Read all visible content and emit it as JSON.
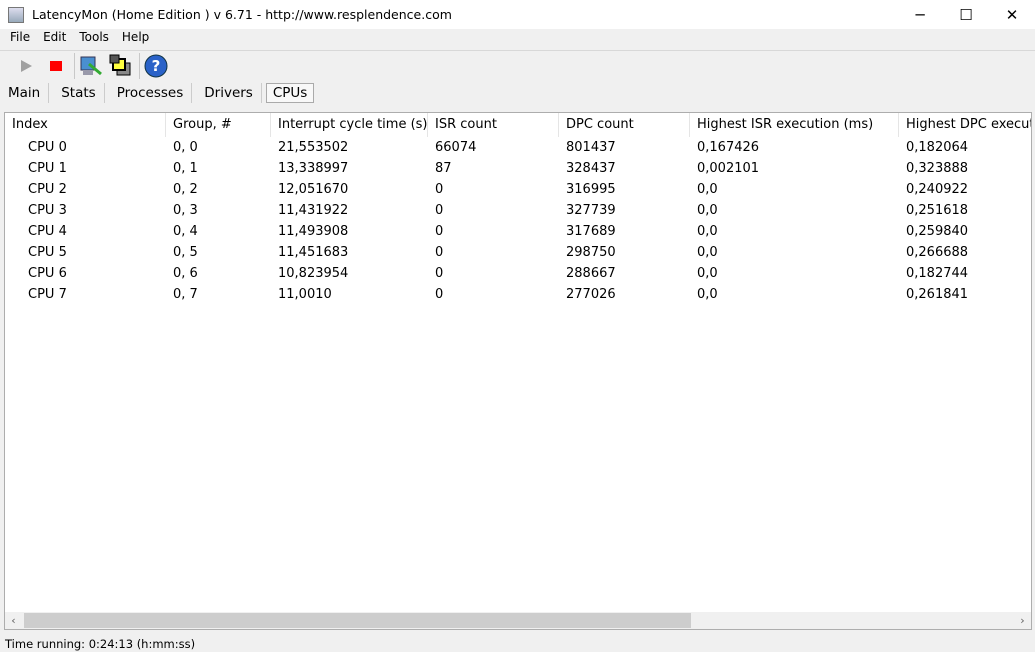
{
  "window": {
    "title": "LatencyMon  (Home Edition )  v 6.71 - http://www.resplendence.com",
    "minimize": "─",
    "maximize": "☐",
    "close": "✕"
  },
  "menu": [
    "File",
    "Edit",
    "Tools",
    "Help"
  ],
  "toolbar": {
    "icons": [
      "play-icon",
      "stop-icon",
      "monitor-icon",
      "windows-icon",
      "help-icon"
    ],
    "stop_color": "#ff0000",
    "help_label": "?"
  },
  "tabs": [
    {
      "label": "Main"
    },
    {
      "label": "Stats"
    },
    {
      "label": "Processes"
    },
    {
      "label": "Drivers"
    },
    {
      "label": "CPUs",
      "active": true
    }
  ],
  "table": {
    "columns": [
      "Index",
      "Group, #",
      "Interrupt cycle time (s)",
      "ISR count",
      "DPC count",
      "Highest ISR execution (ms)",
      "Highest DPC execution (ms)"
    ],
    "rows": [
      [
        "CPU 0",
        "0, 0",
        "21,553502",
        "66074",
        "801437",
        "0,167426",
        "0,182064"
      ],
      [
        "CPU 1",
        "0, 1",
        "13,338997",
        "87",
        "328437",
        "0,002101",
        "0,323888"
      ],
      [
        "CPU 2",
        "0, 2",
        "12,051670",
        "0",
        "316995",
        "0,0",
        "0,240922"
      ],
      [
        "CPU 3",
        "0, 3",
        "11,431922",
        "0",
        "327739",
        "0,0",
        "0,251618"
      ],
      [
        "CPU 4",
        "0, 4",
        "11,493908",
        "0",
        "317689",
        "0,0",
        "0,259840"
      ],
      [
        "CPU 5",
        "0, 5",
        "11,451683",
        "0",
        "298750",
        "0,0",
        "0,266688"
      ],
      [
        "CPU 6",
        "0, 6",
        "10,823954",
        "0",
        "288667",
        "0,0",
        "0,182744"
      ],
      [
        "CPU 7",
        "0, 7",
        "11,0010",
        "0",
        "277026",
        "0,0",
        "0,261841"
      ]
    ]
  },
  "scrollbar": {
    "left": "‹",
    "right": "›"
  },
  "status": {
    "text": "Time running: 0:24:13  (h:mm:ss)"
  }
}
